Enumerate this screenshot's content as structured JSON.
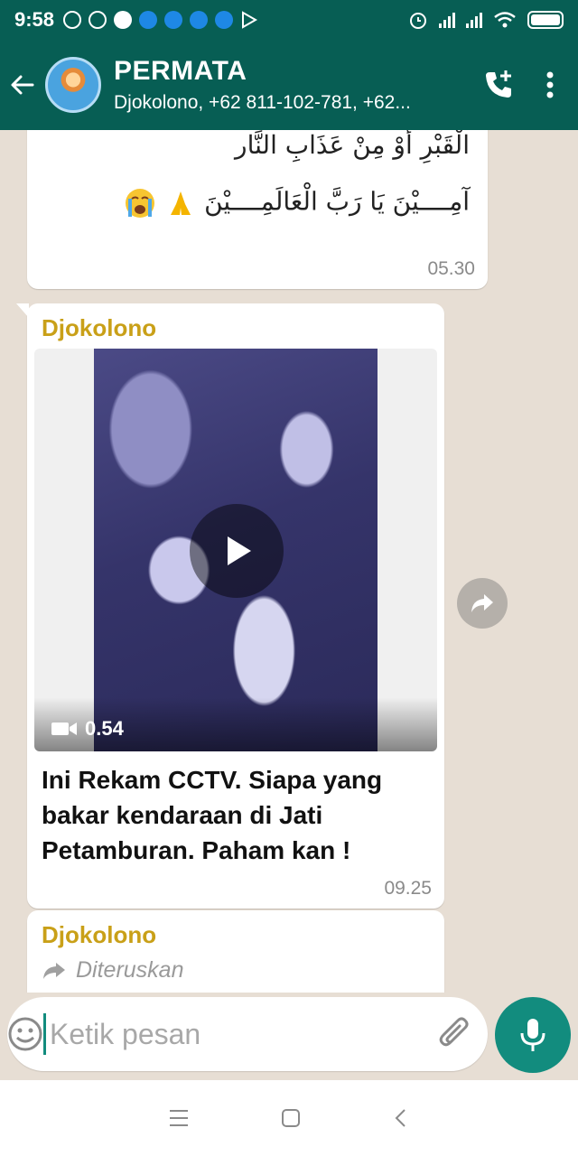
{
  "status_bar": {
    "time": "9:58"
  },
  "header": {
    "title": "PERMATA",
    "subtitle": "Djokolono, +62 811-102-781, +62..."
  },
  "messages": [
    {
      "arabic_line1": "الْقَبْرِ أَوْ مِنْ عَذَابِ النَّار",
      "arabic_line2": "آمِــــيْنَ يَا رَبَّ الْعَالَمِــــيْنَ",
      "time": "05.30"
    },
    {
      "sender": "Djokolono",
      "video_duration": "0.54",
      "caption": "Ini Rekam CCTV. Siapa yang bakar kendaraan di Jati Petamburan. Paham kan !",
      "time": "09.25"
    },
    {
      "sender": "Djokolono",
      "forwarded_label": "Diteruskan"
    }
  ],
  "composer": {
    "placeholder": "Ketik pesan"
  },
  "colors": {
    "header": "#075e54",
    "accent": "#128c7e",
    "sender": "#c9a018"
  }
}
